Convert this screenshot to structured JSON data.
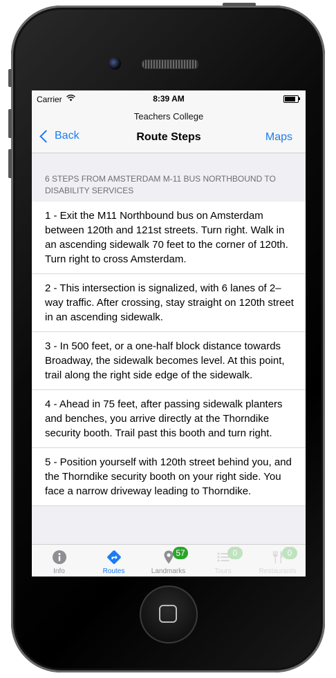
{
  "status": {
    "carrier": "Carrier",
    "time": "8:39 AM",
    "battery_level": 0.85
  },
  "nav": {
    "subtitle": "Teachers College",
    "title": "Route Steps",
    "back_label": "Back",
    "right_label": "Maps"
  },
  "section_header": "6 STEPS FROM AMSTERDAM M-11 BUS NORTHBOUND TO DISABILITY SERVICES",
  "steps": [
    "1 - Exit the M11 Northbound bus on Amsterdam between 120th and 121st streets. Turn right. Walk in an ascending sidewalk 70 feet to the corner of 120th. Turn right to cross Amsterdam.",
    "2 - This intersection is signalized, with 6 lanes of 2–way traffic. After crossing, stay straight on 120th street in an ascending sidewalk.",
    "3 - In 500 feet, or a one-half block distance towards Broadway, the sidewalk becomes level. At this point, trail along the right side edge of the sidewalk.",
    "4 - Ahead in 75 feet, after passing sidewalk planters and benches, you arrive directly at the Thorndike security booth. Trail past this booth and turn right.",
    "5 - Position yourself with 120th street behind you, and the Thorndike security booth on your right side. You face a narrow driveway leading to Thorndike."
  ],
  "tabs": [
    {
      "label": "Info",
      "icon": "info-icon"
    },
    {
      "label": "Routes",
      "icon": "routes-icon"
    },
    {
      "label": "Landmarks",
      "icon": "location-pin-icon",
      "badge": "57"
    },
    {
      "label": "Tours",
      "icon": "list-icon",
      "badge": "0"
    },
    {
      "label": "Restaurants",
      "icon": "fork-knife-icon",
      "badge": "0"
    }
  ],
  "colors": {
    "accent": "#1b7cf4",
    "badge": "#2aa52a",
    "inactive": "#8e8e93"
  }
}
